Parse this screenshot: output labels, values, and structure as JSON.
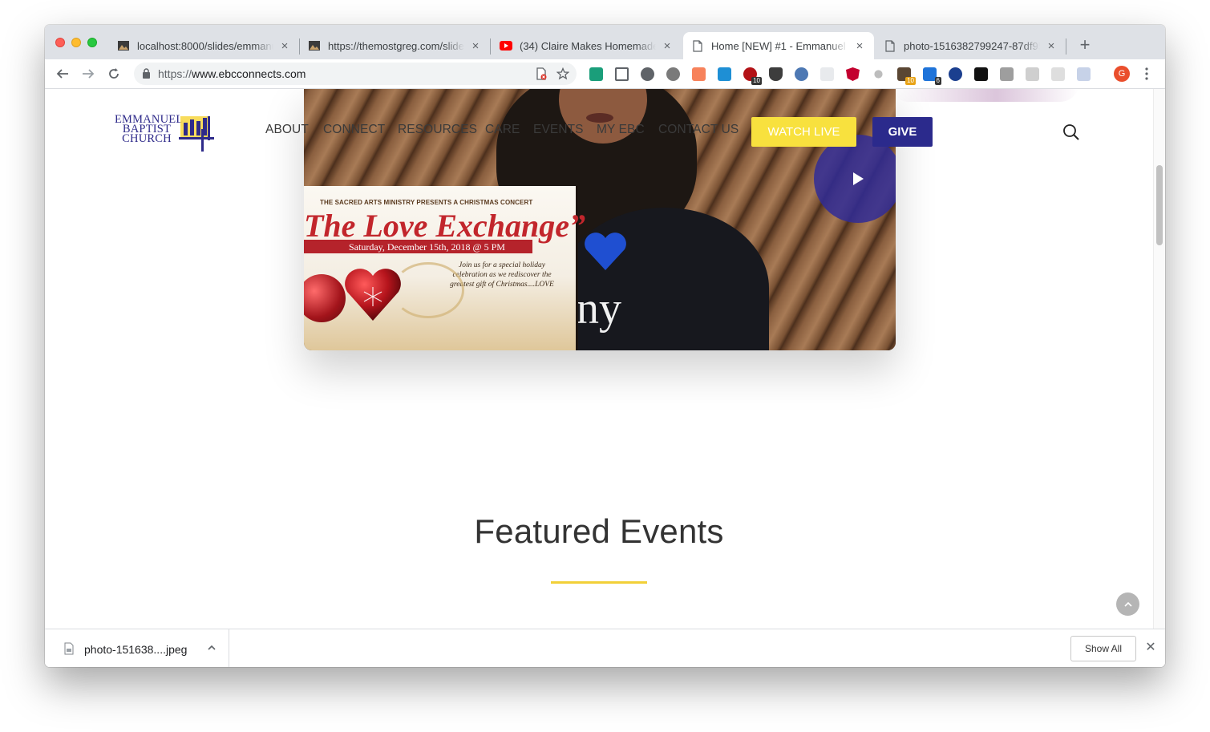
{
  "browser": {
    "tabs": [
      {
        "title": "localhost:8000/slides/emmanu",
        "icon": "slides-icon",
        "active": false
      },
      {
        "title": "https://themostgreg.com/slide",
        "icon": "slides-icon",
        "active": false
      },
      {
        "title": "(34) Claire Makes Homemade I",
        "icon": "youtube-icon",
        "active": false
      },
      {
        "title": "Home [NEW] #1 - Emmanuel Ba",
        "icon": "page-icon",
        "active": true
      },
      {
        "title": "photo-1516382799247-87df95",
        "icon": "page-icon",
        "active": false
      }
    ],
    "close_glyph": "×",
    "new_tab_glyph": "+",
    "url_scheme": "https://",
    "url_host": "www.ebcconnects.com",
    "profile_initial": "G",
    "extension_badges": [
      "10",
      "10",
      "6"
    ]
  },
  "site": {
    "logo_lines": [
      "EMMANUEL",
      "BAPTIST",
      "CHURCH"
    ],
    "nav": [
      "ABOUT",
      "CONNECT",
      "RESOURCES",
      "CARE",
      "EVENTS",
      "MY EBC",
      "CONTACT US"
    ],
    "watch_live": "WATCH LIVE",
    "give": "GIVE"
  },
  "video": {
    "poster_kicker": "THE SACRED ARTS MINISTRY PRESENTS A CHRISTMAS CONCERT",
    "poster_title": "The Love Exchange”",
    "poster_date": "Saturday, December 15th, 2018 @ 5 PM",
    "poster_body": "Join us for a special holiday celebration as we rediscover the greatest gift of Christmas....LOVE",
    "shirt_text": "ny"
  },
  "main": {
    "featured_heading": "Featured Events"
  },
  "downloads": {
    "file_name": "photo-151638....jpeg",
    "show_all": "Show All",
    "close_glyph": "✕"
  },
  "colors": {
    "accent_yellow": "#f8e13e",
    "brand_navy": "#2b2a8c",
    "rule_yellow": "#f2d038"
  }
}
